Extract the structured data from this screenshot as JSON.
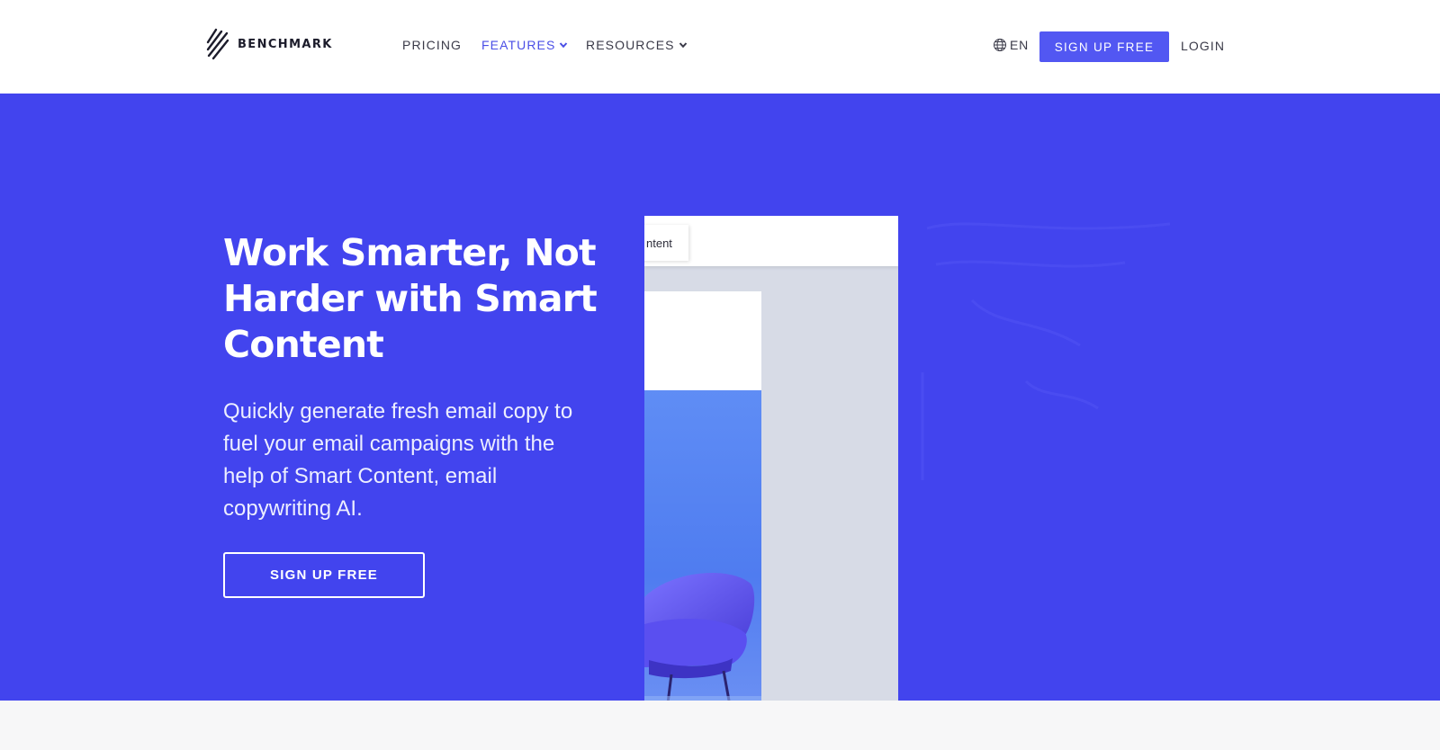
{
  "brand": {
    "name": "BENCHMARK"
  },
  "nav": {
    "pricing": "PRICING",
    "features": "FEATURES",
    "resources": "RESOURCES",
    "language": "EN",
    "signup": "SIGN UP FREE",
    "login": "LOGIN"
  },
  "hero": {
    "title": "Work Smarter, Not Harder with Smart Content",
    "description": "Quickly generate fresh email copy to fuel your email campaigns with the help of Smart Content, email copywriting AI.",
    "cta": "SIGN UP FREE"
  },
  "mockup": {
    "tab_label": "ntent"
  },
  "colors": {
    "accent": "#5257f2",
    "hero_bg": "#4244ee",
    "nav_active": "#4a4ee6"
  },
  "icons": {
    "logo": "benchmark-logo-icon",
    "chevron": "chevron-down-icon",
    "globe": "globe-icon"
  }
}
